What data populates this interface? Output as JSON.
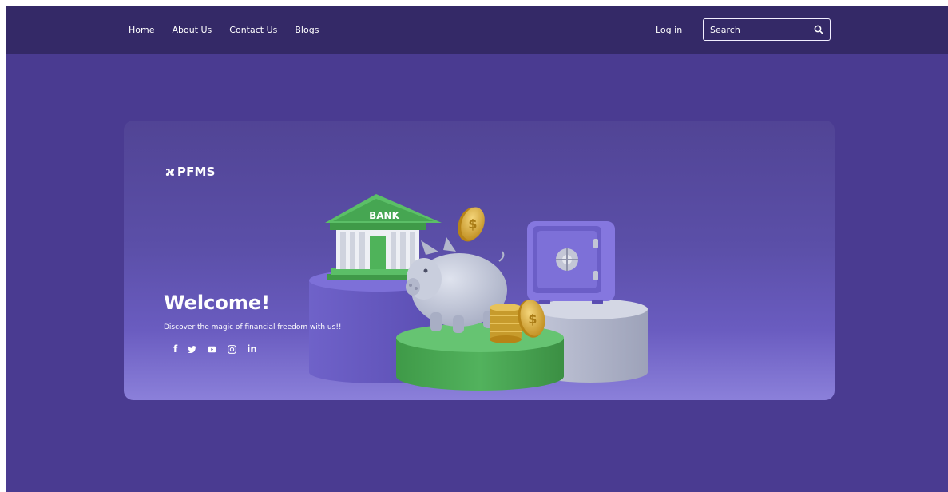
{
  "nav": {
    "links": [
      "Home",
      "About Us",
      "Contact Us",
      "Blogs"
    ],
    "login_label": "Log in",
    "search_placeholder": "Search"
  },
  "hero": {
    "brand_mark": "ϰ",
    "brand_name": "PFMS",
    "title": "Welcome!",
    "tagline": "Discover the magic of financial freedom with us!!",
    "bank_sign": "BANK",
    "social": {
      "facebook": "f",
      "linkedin": "in"
    },
    "social_icons": [
      "facebook-icon",
      "twitter-icon",
      "youtube-icon",
      "instagram-icon",
      "linkedin-icon"
    ]
  },
  "colors": {
    "page_bg": "#4a3b91",
    "navbar_bg": "#342967",
    "bank_green": "#4fb35a",
    "vault_purple": "#8577df",
    "coin_gold": "#d6a935"
  }
}
